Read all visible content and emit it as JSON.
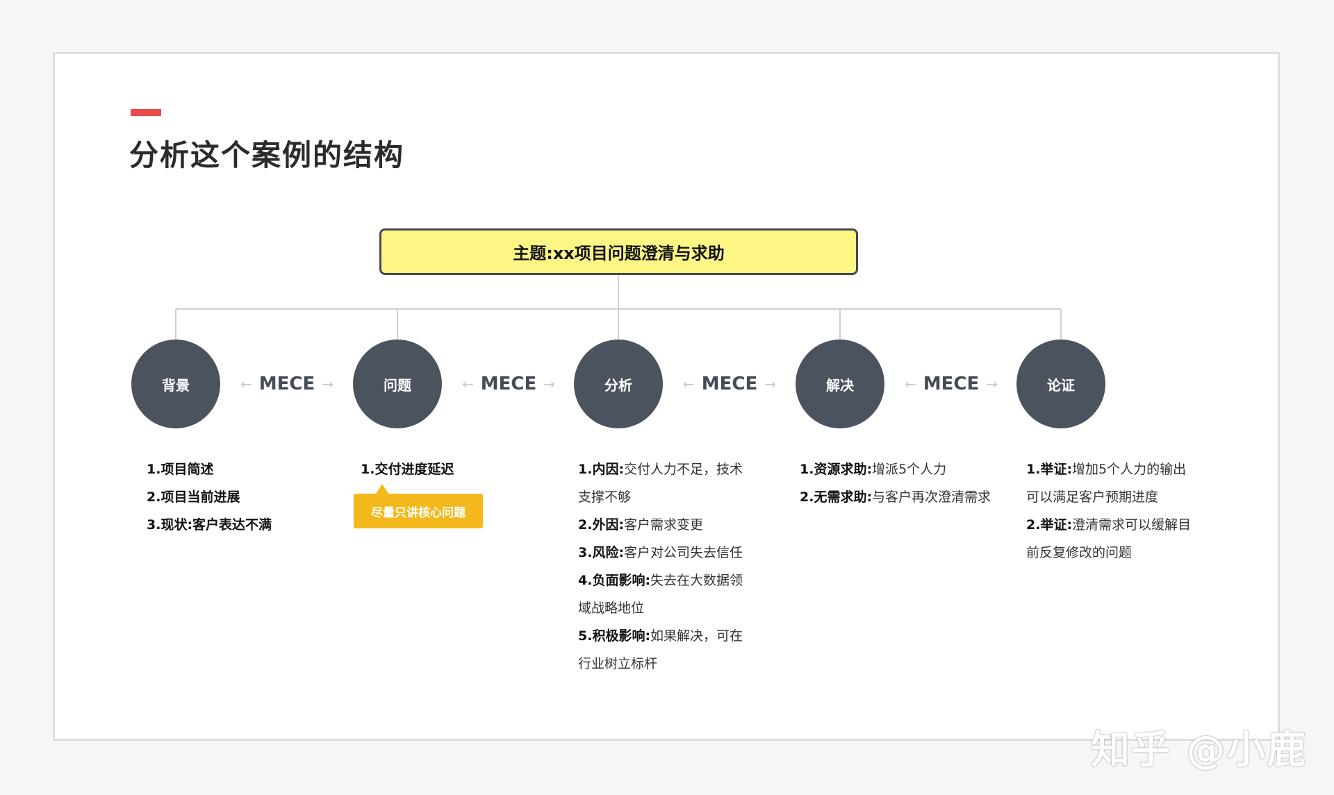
{
  "page_title": "分析这个案例的结构",
  "topic": "主题:xx项目问题澄清与求助",
  "mece_label": "MECE",
  "nodes": [
    "背景",
    "问题",
    "分析",
    "解决",
    "论证"
  ],
  "columns": {
    "background": [
      "1.项目简述",
      "2.项目当前进展",
      "3.现状:客户表达不满"
    ],
    "problem": {
      "item": "1.交付进度延迟",
      "callout": "尽量只讲核心问题"
    },
    "analysis": [
      {
        "label": "1.内因:",
        "text": "交付人力不足，技术",
        "cont": "支撑不够"
      },
      {
        "label": "2.外因:",
        "text": "客户需求变更"
      },
      {
        "label": "3.风险:",
        "text": "客户对公司失去信任"
      },
      {
        "label": "4.负面影响:",
        "text": "失去在大数据领",
        "cont": "域战略地位"
      },
      {
        "label": "5.积极影响:",
        "text": "如果解决，可在",
        "cont": "行业树立标杆"
      }
    ],
    "solution": [
      {
        "label": "1.资源求助:",
        "text": "增派5个人力"
      },
      {
        "label": "2.无需求助:",
        "text": "与客户再次澄清需求"
      }
    ],
    "proof": [
      {
        "label": "1.举证:",
        "text": "增加5个人力的输出",
        "cont": "可以满足客户预期进度"
      },
      {
        "label": "2.举证:",
        "text": "澄清需求可以缓解目",
        "cont": "前反复修改的问题"
      }
    ]
  },
  "watermark": "知乎 @小鹿",
  "colors": {
    "accent": "#e64a4a",
    "topic_fill": "#fdf584",
    "node_fill": "#4b535e",
    "callout_fill": "#f3b81c"
  }
}
